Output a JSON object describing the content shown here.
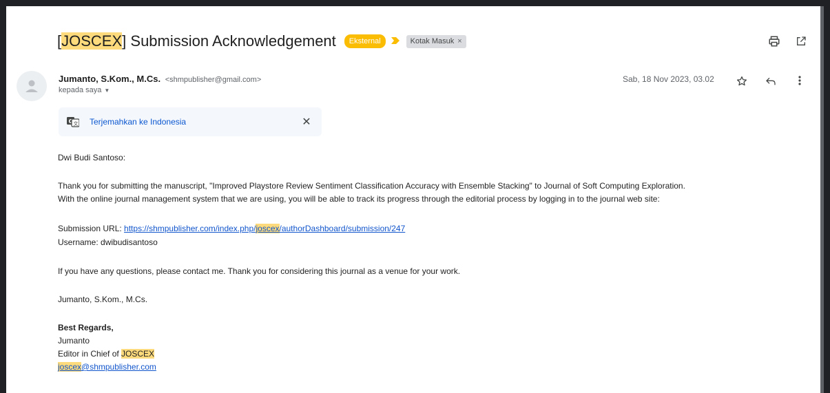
{
  "email": {
    "subject_highlight": "JOSCEX",
    "subject_rest": " Submission Acknowledgement",
    "labels": {
      "external": "Eksternal",
      "inbox": "Kotak Masuk",
      "inbox_remove": "×"
    },
    "sender": {
      "name": "Jumanto, S.Kom., M.Cs.",
      "email": "<shmpublisher@gmail.com>",
      "to_line": "kepada saya"
    },
    "date": "Sab, 18 Nov 2023, 03.02",
    "translate": {
      "link": "Terjemahkan ke Indonesia"
    }
  },
  "message": {
    "greeting": "Dwi Budi Santoso:",
    "para1_line1": "Thank you for submitting the manuscript, \"Improved Playstore Review Sentiment Classification Accuracy with Ensemble Stacking\" to Journal of Soft Computing Exploration.",
    "para1_line2": "With the online journal management system that we are using, you will be able to track its progress through the editorial process by logging in to the journal web site:",
    "url_label": "Submission URL: ",
    "url_part1": "https://shmpublisher.com/index.php/",
    "url_highlight": "joscex",
    "url_part2": "/authorDashboard/submission/247",
    "username_line": "Username: dwibudisantoso",
    "para3": "If you have any questions, please contact me. Thank you for considering this journal as a venue for your work.",
    "signoff_name": "Jumanto, S.Kom., M.Cs.",
    "regards": "Best Regards,",
    "sig_name": "Jumanto",
    "sig_role_prefix": "Editor in Chief of ",
    "sig_role_highlight": "JOSCEX",
    "sig_email_highlight": "joscex",
    "sig_email_rest": "@shmpublisher.com"
  },
  "colors": {
    "highlight": "#fddb7d",
    "external_label": "#fbbc04",
    "link": "#1155cc"
  }
}
